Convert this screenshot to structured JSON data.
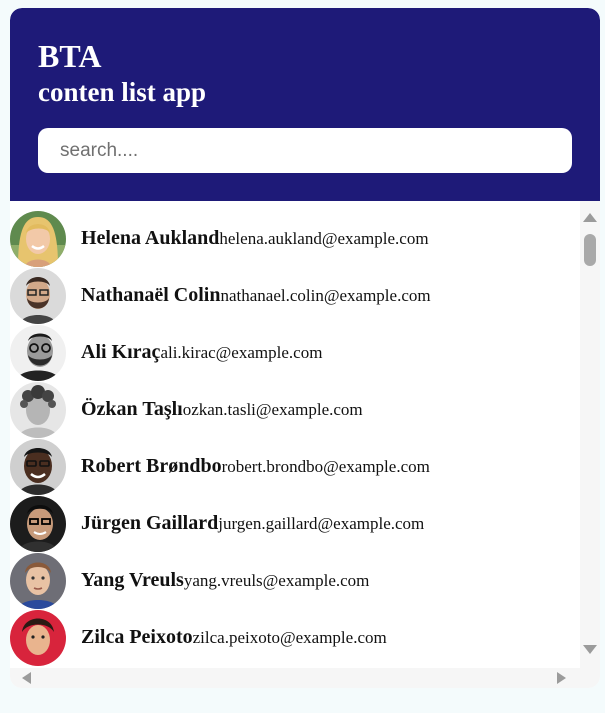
{
  "header": {
    "title": "BTA",
    "subtitle": "conten list app",
    "background_color": "#1e1a78"
  },
  "search": {
    "placeholder": "search....",
    "value": ""
  },
  "contacts": [
    {
      "name": "Helena Aukland",
      "email": "helena.aukland@example.com",
      "avatar": "woman-blonde-avatar"
    },
    {
      "name": "Nathanaël Colin",
      "email": "nathanael.colin@example.com",
      "avatar": "man-glasses-beard-avatar"
    },
    {
      "name": "Ali Kıraç",
      "email": "ali.kirac@example.com",
      "avatar": "man-glasses-bw-avatar"
    },
    {
      "name": "Özkan Taşlı",
      "email": "ozkan.tasli@example.com",
      "avatar": "man-curly-hair-bw-avatar"
    },
    {
      "name": "Robert Brøndbo",
      "email": "robert.brondbo@example.com",
      "avatar": "man-glasses-smiling-avatar"
    },
    {
      "name": "Jürgen Gaillard",
      "email": "jurgen.gaillard@example.com",
      "avatar": "man-glasses-dark-avatar"
    },
    {
      "name": "Yang Vreuls",
      "email": "yang.vreuls@example.com",
      "avatar": "young-man-avatar"
    },
    {
      "name": "Zilca Peixoto",
      "email": "zilca.peixoto@example.com",
      "avatar": "person-red-background-avatar"
    }
  ]
}
